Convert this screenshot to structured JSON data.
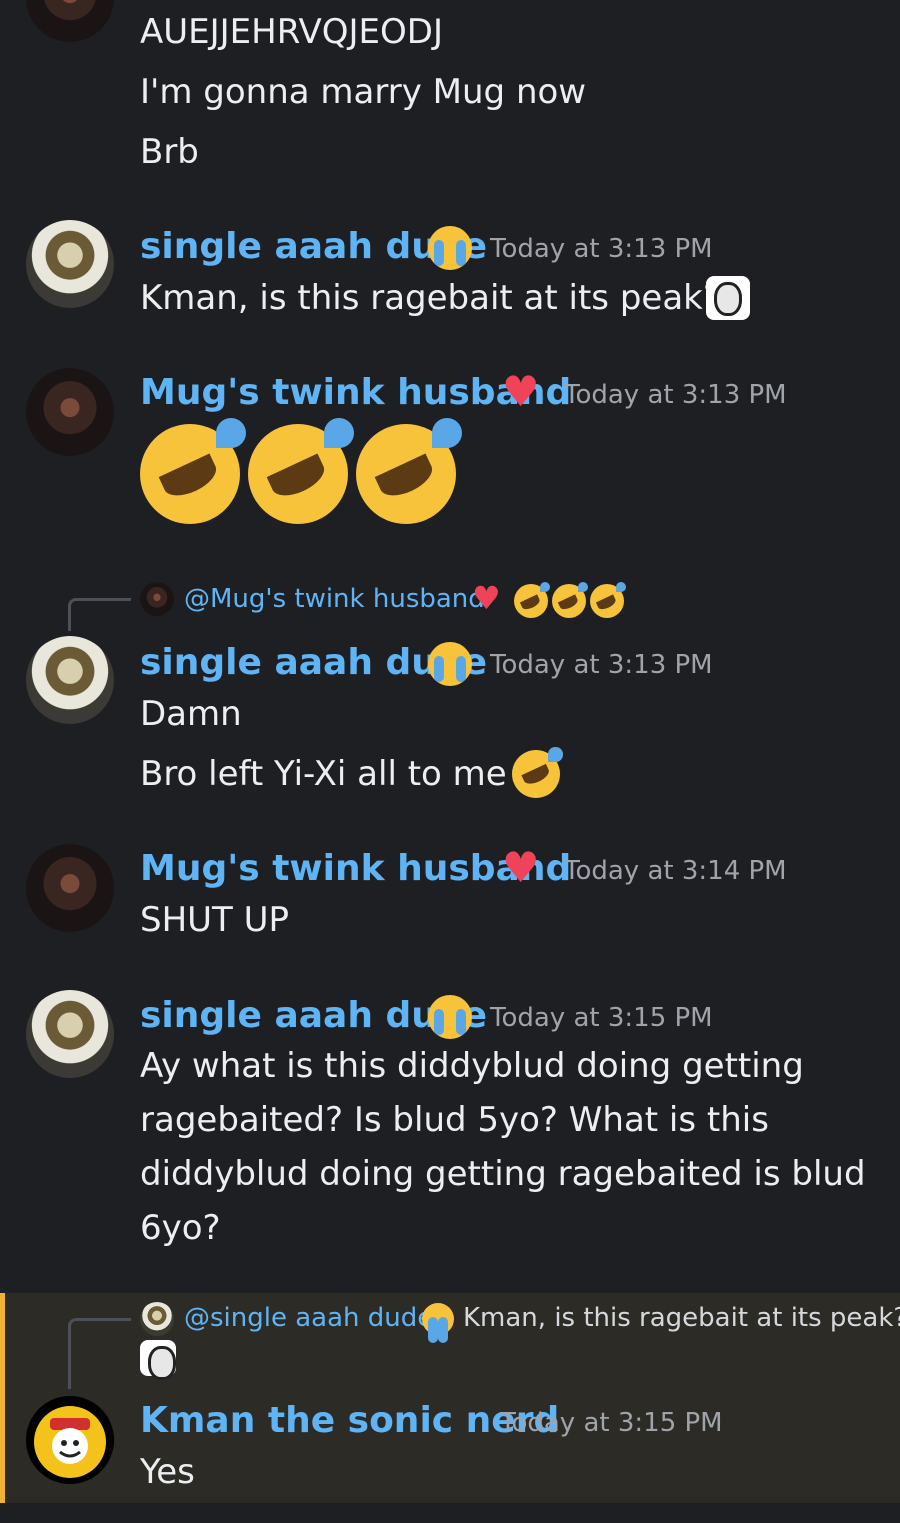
{
  "messages": [
    {
      "lines": [
        "AUEJJEHRVQJEODJ",
        "I'm gonna marry Mug now",
        "Brb"
      ]
    },
    {
      "username": "single aaah dude",
      "timestamp": "Today at 3:13 PM",
      "lines": [
        "Kman, is this ragebait at its peak?"
      ]
    },
    {
      "username": "Mug's twink husband",
      "timestamp": "Today at 3:13 PM"
    },
    {
      "reply": {
        "name": "@Mug's twink husband"
      },
      "username": "single aaah dude",
      "timestamp": "Today at 3:13 PM",
      "lines": [
        "Damn",
        "Bro left Yi-Xi all to me"
      ]
    },
    {
      "username": "Mug's twink husband",
      "timestamp": "Today at 3:14 PM",
      "lines": [
        "SHUT UP"
      ]
    },
    {
      "username": "single aaah dude",
      "timestamp": "Today at 3:15 PM",
      "lines": [
        "Ay what is this diddyblud doing getting",
        "ragebaited? Is blud 5yo? What is this",
        "diddyblud doing getting ragebaited is blud",
        "6yo?"
      ]
    },
    {
      "reply": {
        "name": "@single aaah dude",
        "text": "Kman, is this ragebait at its peak?"
      },
      "username": "Kman the sonic nerd",
      "timestamp": "Today at 3:15 PM",
      "lines": [
        "Yes"
      ]
    }
  ],
  "colors": {
    "username": "#5fb4f6",
    "background": "#1e1f22",
    "highlight": "#2c2b26",
    "highlight_border": "#f0b232"
  },
  "icons": [
    "loudly-crying-face-icon",
    "red-heart-icon",
    "rolling-on-floor-laughing-icon"
  ]
}
